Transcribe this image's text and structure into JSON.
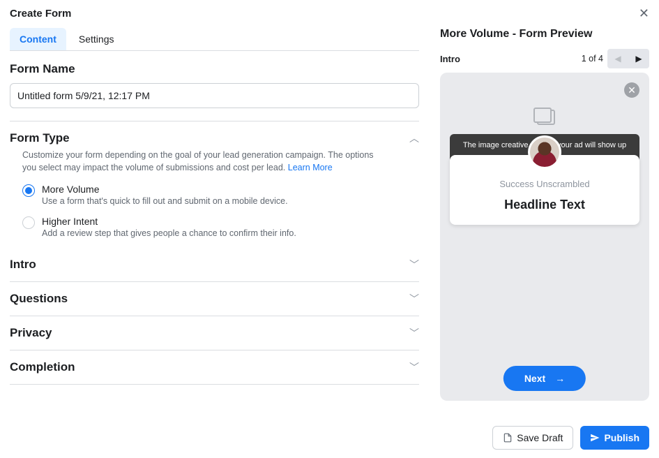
{
  "header": {
    "title": "Create Form"
  },
  "tabs": {
    "content": "Content",
    "settings": "Settings"
  },
  "form_name": {
    "label": "Form Name",
    "value": "Untitled form 5/9/21, 12:17 PM"
  },
  "form_type": {
    "title": "Form Type",
    "description": "Customize your form depending on the goal of your lead generation campaign. The options you select may impact the volume of submissions and cost per lead.",
    "learn_more": "Learn More",
    "options": [
      {
        "label": "More Volume",
        "sub": "Use a form that's quick to fill out and submit on a mobile device.",
        "selected": true
      },
      {
        "label": "Higher Intent",
        "sub": "Add a review step that gives people a chance to confirm their info.",
        "selected": false
      }
    ]
  },
  "sections": {
    "intro": "Intro",
    "questions": "Questions",
    "privacy": "Privacy",
    "completion": "Completion"
  },
  "preview": {
    "title": "More Volume - Form Preview",
    "step_label": "Intro",
    "counter": "1 of 4",
    "banner": "The image creative used in your ad will show up",
    "brand": "Success Unscrambled",
    "headline": "Headline Text",
    "next": "Next"
  },
  "footer": {
    "save_draft": "Save Draft",
    "publish": "Publish"
  }
}
